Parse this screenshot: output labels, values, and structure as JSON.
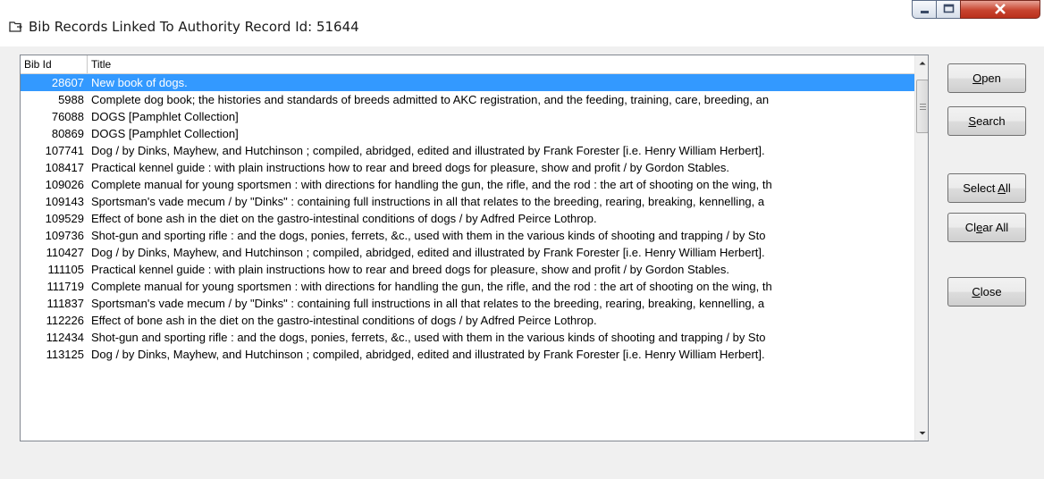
{
  "window": {
    "title": "Bib Records Linked To Authority Record Id: 51644",
    "icon": "folder-link-icon"
  },
  "list": {
    "columns": [
      "Bib Id",
      "Title"
    ],
    "selected_row": 0,
    "rows": [
      {
        "id": "28607",
        "title": "New book of dogs."
      },
      {
        "id": "5988",
        "title": "Complete dog book; the histories and standards of breeds admitted to AKC registration, and the feeding, training, care, breeding, an"
      },
      {
        "id": "76088",
        "title": "DOGS [Pamphlet Collection]"
      },
      {
        "id": "80869",
        "title": "DOGS [Pamphlet Collection]"
      },
      {
        "id": "107741",
        "title": "Dog / by Dinks, Mayhew, and Hutchinson ; compiled, abridged, edited and illustrated by Frank Forester [i.e. Henry William Herbert]."
      },
      {
        "id": "108417",
        "title": "Practical kennel guide : with plain instructions how to rear and breed dogs for pleasure, show and profit / by Gordon Stables."
      },
      {
        "id": "109026",
        "title": "Complete manual for young sportsmen : with directions for handling the gun, the rifle, and the rod : the art of shooting on the wing, th"
      },
      {
        "id": "109143",
        "title": "Sportsman's vade mecum / by \"Dinks\" : containing full instructions in all that relates to the breeding, rearing, breaking, kennelling, a"
      },
      {
        "id": "109529",
        "title": "Effect of bone ash in the diet on the gastro-intestinal conditions of dogs / by Adfred Peirce Lothrop."
      },
      {
        "id": "109736",
        "title": "Shot-gun and sporting rifle : and the dogs, ponies, ferrets, &c., used with them in the various kinds of shooting and trapping / by Sto"
      },
      {
        "id": "110427",
        "title": "Dog / by Dinks, Mayhew, and Hutchinson ; compiled, abridged, edited and illustrated by Frank Forester [i.e. Henry William Herbert]."
      },
      {
        "id": "111105",
        "title": "Practical kennel guide : with plain instructions how to rear and breed dogs for pleasure, show and profit / by Gordon Stables."
      },
      {
        "id": "111719",
        "title": "Complete manual for young sportsmen : with directions for handling the gun, the rifle, and the rod : the art of shooting on the wing, th"
      },
      {
        "id": "111837",
        "title": "Sportsman's vade mecum / by \"Dinks\" : containing full instructions in all that relates to the breeding, rearing, breaking, kennelling, a"
      },
      {
        "id": "112226",
        "title": "Effect of bone ash in the diet on the gastro-intestinal conditions of dogs / by Adfred Peirce Lothrop."
      },
      {
        "id": "112434",
        "title": "Shot-gun and sporting rifle : and the dogs, ponies, ferrets, &c., used with them in the various kinds of shooting and trapping / by Sto"
      },
      {
        "id": "113125",
        "title": "Dog / by Dinks, Mayhew, and Hutchinson ; compiled, abridged, edited and illustrated by Frank Forester [i.e. Henry William Herbert]."
      }
    ]
  },
  "buttons": {
    "open": {
      "pre": "",
      "key": "O",
      "post": "pen"
    },
    "search": {
      "pre": "",
      "key": "S",
      "post": "earch"
    },
    "select_all": {
      "pre": "Select ",
      "key": "A",
      "post": "ll"
    },
    "clear_all": {
      "pre": "Cl",
      "key": "e",
      "post": "ar All"
    },
    "close": {
      "pre": "",
      "key": "C",
      "post": "lose"
    }
  },
  "colors": {
    "selection": "#3399ff",
    "window_bg": "#f0f0f0"
  }
}
